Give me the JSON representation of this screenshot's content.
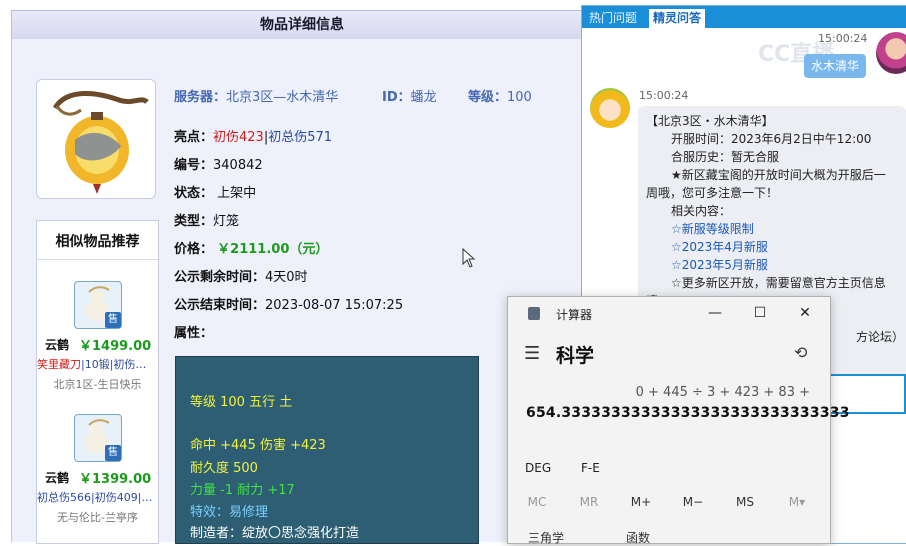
{
  "item": {
    "page_title": "物品详细信息",
    "server_label": "服务器：",
    "server_value": "北京3区—水木清华",
    "id_label": "ID：",
    "id_value": "蟠龙",
    "level_label": "等级：",
    "level_value": "100",
    "highlight_label": "亮点：",
    "highlight_red": "初伤423",
    "highlight_sep": "|",
    "highlight_blue": "初总伤571",
    "number_label": "编号：",
    "number_value": "340842",
    "status_label": "状态：",
    "status_value": "上架中",
    "type_label": "类型：",
    "type_value": "灯笼",
    "price_label": "价格：",
    "price_value": "￥2111.00（元）",
    "remaining_label": "公示剩余时间：",
    "remaining_value": "4天0时",
    "end_label": "公示结束时间：",
    "end_value": "2023-08-07 15:07:25",
    "attr_label": "属性：",
    "stats": {
      "level_line": "等级 100 五行 土",
      "hit_line": "命中 +445 伤害 +423",
      "durability_line": "耐久度 500",
      "strength_line": "力量 -1 耐力 +17",
      "effect_line": "特效：易修理",
      "maker_line": "制造者：绽放〇思念强化打造"
    }
  },
  "similar": {
    "title": "相似物品推荐",
    "badge": "售",
    "items": [
      {
        "name": "云鹤",
        "price": "￥1499.00",
        "tag_red": "笑里藏刀",
        "tag_rest": "|10锻|初伤…",
        "server": "北京1区-生日快乐"
      },
      {
        "name": "云鹤",
        "price": "￥1399.00",
        "tag_red": "",
        "tag_rest": "初总伤566|初伤409|…",
        "server": "无与伦比-兰亭序"
      }
    ]
  },
  "chat": {
    "tab_hot": "热门问题",
    "tab_sprite": "精灵问答",
    "time_1": "15:00:24",
    "user_message": "水木清华",
    "time_2": "15:00:24",
    "watermark": "CC直播",
    "bot_lines": [
      {
        "text": "【北京3区・水木清华】",
        "indent": 0
      },
      {
        "text": "开服时间：2023年6月2日中午12:00",
        "indent": 1
      },
      {
        "text": "合服历史：暂无合服",
        "indent": 1
      },
      {
        "text": "★新区藏宝阁的开放时间大概为开服后一",
        "indent": 1
      },
      {
        "text": "周哦，您可多注意一下！",
        "indent": 0
      },
      {
        "text": "相关内容：",
        "indent": 1
      },
      {
        "text": "☆新服等级限制",
        "indent": 1,
        "link": true
      },
      {
        "text": "☆2023年4月新服",
        "indent": 1,
        "link": true
      },
      {
        "text": "☆2023年5月新服",
        "indent": 1,
        "link": true
      },
      {
        "text": "☆更多新区开放，需要留意官方主页信息",
        "indent": 1
      },
      {
        "text": "哦",
        "indent": 0
      },
      {
        "text": "方论坛）",
        "indent": 2
      }
    ]
  },
  "calculator": {
    "title": "计算器",
    "mode": "科学",
    "expression": "0 + 445 ÷ 3 + 423 + 83 +",
    "result": "654.33333333333333333333333333333",
    "deg_label": "DEG",
    "fe_label": "F-E",
    "memory_buttons": [
      "MC",
      "MR",
      "M+",
      "M−",
      "MS",
      "M▾"
    ],
    "bottom_left": "三角学",
    "bottom_right": "函数",
    "minimize": "—",
    "maximize": "☐",
    "close": "✕",
    "menu_icon": "☰",
    "history_icon": "⟲"
  }
}
